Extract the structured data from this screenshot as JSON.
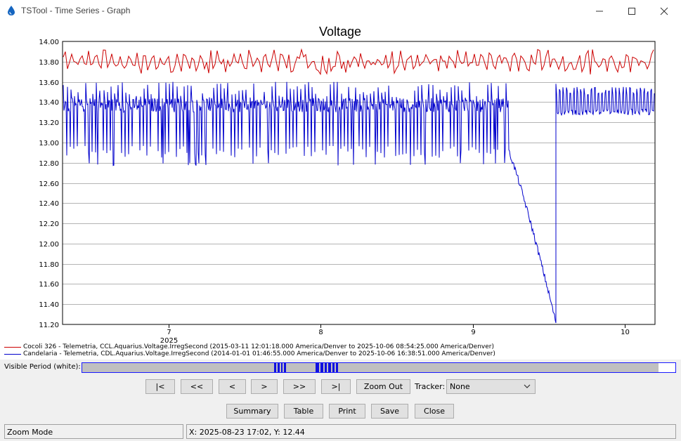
{
  "window": {
    "title": "TSTool - Time Series - Graph",
    "controls": [
      "minimize",
      "maximize",
      "close"
    ]
  },
  "chart_data": {
    "type": "line",
    "title": "Voltage",
    "x_axis": {
      "year_label": "2025",
      "ticks": [
        "7",
        "8",
        "9",
        "10"
      ],
      "range_months": [
        6.3,
        10.2
      ]
    },
    "y_axis": {
      "range": [
        11.2,
        14.0
      ],
      "ticks": [
        "14.00",
        "13.80",
        "13.60",
        "13.40",
        "13.20",
        "13.00",
        "12.80",
        "12.60",
        "12.40",
        "12.20",
        "12.00",
        "11.80",
        "11.60",
        "11.40",
        "11.20"
      ],
      "grid": true
    },
    "series": [
      {
        "name": "Cocoli 326 - Telemetria, CCL.Aquarius.Voltage.IrregSecond (2015-03-11 12:01:18.000 America/Denver to 2025-10-06 08:54:25.000 America/Denver)",
        "color": "#cc0000",
        "min": 13.67,
        "max": 13.92
      },
      {
        "name": "Candelaria - Telemetria, CDL.Aquarius.Voltage.IrregSecond (2014-01-01 01:46:55.000 America/Denver to 2025-10-06 16:38:51.000 America/Denver)",
        "color": "#0000cc",
        "daily_cycle_min": 12.85,
        "daily_cycle_max": 13.6,
        "decline_end": 11.22,
        "recovery_range": [
          13.27,
          13.55
        ]
      }
    ],
    "legend_placement": "bottom"
  },
  "visible_period": {
    "label": "Visible Period (white):"
  },
  "navigation": {
    "first": "|<",
    "page_back": "<<",
    "back": "<",
    "forward": ">",
    "page_forward": ">>",
    "last": ">|",
    "zoom_out": "Zoom Out"
  },
  "tracker": {
    "label": "Tracker:",
    "value": "None"
  },
  "actions": {
    "summary": "Summary",
    "table": "Table",
    "print": "Print",
    "save": "Save",
    "close": "Close"
  },
  "status": {
    "mode": "Zoom Mode",
    "coords": "X:  2025-08-23 17:02,  Y:  12.44"
  },
  "colors": {
    "series_red": "#cc0000",
    "series_blue": "#0000cc",
    "visible_period_marker": "#1010e0"
  }
}
